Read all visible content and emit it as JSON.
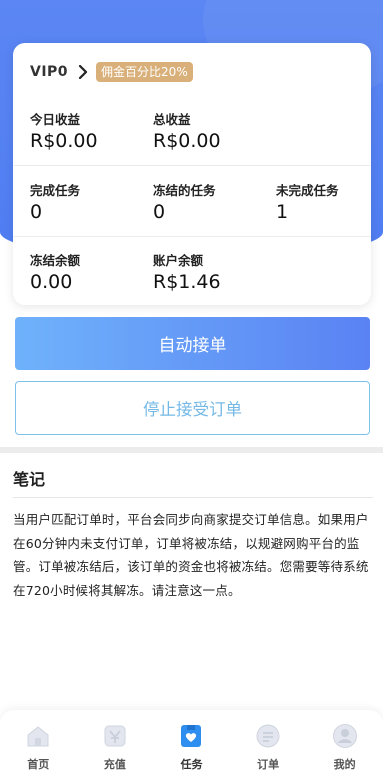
{
  "vip": {
    "level": "VIP0",
    "badge": "佣金百分比20%"
  },
  "stats": {
    "today_income": {
      "label": "今日收益",
      "value": "R$0.00"
    },
    "total_income": {
      "label": "总收益",
      "value": "R$0.00"
    },
    "completed_tasks": {
      "label": "完成任务",
      "value": "0"
    },
    "frozen_tasks": {
      "label": "冻结的任务",
      "value": "0"
    },
    "unfinished_tasks": {
      "label": "未完成任务",
      "value": "1"
    },
    "frozen_balance": {
      "label": "冻结余额",
      "value": "0.00"
    },
    "account_balance": {
      "label": "账户余额",
      "value": "R$1.46"
    }
  },
  "buttons": {
    "auto_accept": "自动接单",
    "stop_accept": "停止接受订单"
  },
  "notes": {
    "title": "笔记",
    "body": "当用户匹配订单时，平台会同步向商家提交订单信息。如果用户在60分钟内未支付订单，订单将被冻结，以规避网购平台的监管。订单被冻结后，该订单的资金也将被冻结。您需要等待系统在720小时候将其解冻。请注意这一点。"
  },
  "tabbar": {
    "items": [
      {
        "label": "首页",
        "icon": "home-icon"
      },
      {
        "label": "充值",
        "icon": "recharge-icon"
      },
      {
        "label": "任务",
        "icon": "task-icon",
        "active": true
      },
      {
        "label": "订单",
        "icon": "order-icon"
      },
      {
        "label": "我的",
        "icon": "profile-icon"
      }
    ]
  },
  "colors": {
    "primary": "#5a82f3",
    "badge": "#d9b07a",
    "stop_border": "#7cc1ea",
    "active_tab": "#2f8ff0"
  }
}
